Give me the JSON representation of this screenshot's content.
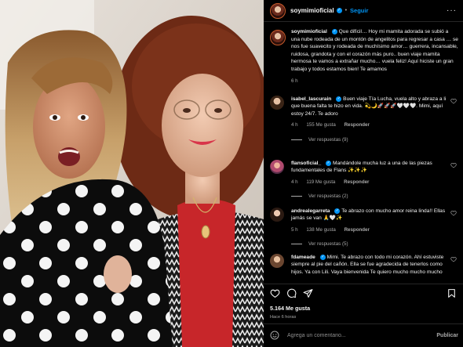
{
  "header": {
    "username": "soymimioficial",
    "verified": true,
    "follow_label": "Seguir",
    "more_icon": "more-horizontal-icon"
  },
  "caption": {
    "username": "soymimioficial",
    "text": "Que difícil… Hoy mi mamita adorada se subió a una nube rodeada de un montón de angelitos para regresar a casa … se nos fue suavecito y rodeada de muchísimo amor… guerrera, incansable, ruidosa, grandota y con el corazón más puro.. buen viaje mamita hermosa te vamos a extrañar mucho… vuela feliz! Aquí hiciste un gran trabajo y todos estamos bien! Te amamos",
    "time": "6 h"
  },
  "comments": [
    {
      "username": "isabel_lascurain",
      "text": "Buen viaje Tía Lucha, vuela alto y abraza a li que buena falta te hizo en vida. 💫🌙🚀🚀🚀🤍🤍🤍. Mimi, aquí estoy 24/7. Te adoro",
      "time": "4 h",
      "likes": "155 Me gusta",
      "reply_label": "Responder",
      "view_replies": "Ver respuestas (9)"
    },
    {
      "username": "flansoficial_",
      "text": "Mandándole mucha luz a una de las piezas fundamentales de Flans ✨✨✨",
      "time": "4 h",
      "likes": "119 Me gusta",
      "reply_label": "Responder",
      "view_replies": "Ver respuestas (2)"
    },
    {
      "username": "andrealegarreta",
      "text": "Te abrazo con mucho amor reina linda!! Ellas jamás se van 🙏🤍✨",
      "time": "5 h",
      "likes": "138 Me gusta",
      "reply_label": "Responder",
      "view_replies": "Ver respuestas (5)"
    },
    {
      "username": "fdameade",
      "text": "Mimi. Te abrazo con todo mi corazón. Ahí estuviste siempre al pie del cañón. Ella se fue agradecida de tenerlos como hijos. Ya con Lili. Vaya bienvenida Te quiero mucho mucho mucho"
    }
  ],
  "footer": {
    "likes": "5.164 Me gusta",
    "time": "Hace 6 horas",
    "comment_placeholder": "Agrega un comentario...",
    "post_label": "Publicar"
  },
  "colors": {
    "background": "#000000",
    "accent": "#0095f6",
    "muted": "#a8a8a8",
    "border": "#262626"
  },
  "icons": [
    "heart-icon",
    "comment-icon",
    "share-icon",
    "bookmark-icon",
    "emoji-icon",
    "like-comment-icon",
    "verified-icon"
  ]
}
